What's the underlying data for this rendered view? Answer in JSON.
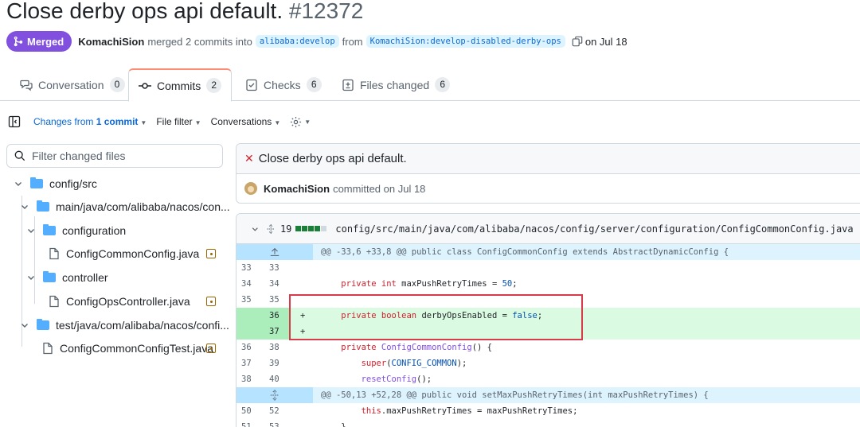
{
  "pr": {
    "title": "Close derby ops api default.",
    "number": "#12372",
    "status": "Merged",
    "author": "KomachiSion",
    "merge_text": "merged 2 commits into",
    "base_branch": "alibaba:develop",
    "from_text": "from",
    "head_branch": "KomachiSion:develop-disabled-derby-ops",
    "date_text": "on Jul 18"
  },
  "tabs": [
    {
      "label": "Conversation",
      "count": "0"
    },
    {
      "label": "Commits",
      "count": "2"
    },
    {
      "label": "Checks",
      "count": "6"
    },
    {
      "label": "Files changed",
      "count": "6"
    }
  ],
  "toolbar": {
    "changes_prefix": "Changes from",
    "changes_value": "1 commit",
    "file_filter": "File filter",
    "conversations": "Conversations"
  },
  "sidebar": {
    "filter_placeholder": "Filter changed files",
    "tree": [
      {
        "label": "config/src",
        "type": "folder"
      },
      {
        "label": "main/java/com/alibaba/nacos/con...",
        "type": "folder"
      },
      {
        "label": "configuration",
        "type": "folder"
      },
      {
        "label": "ConfigCommonConfig.java",
        "type": "file"
      },
      {
        "label": "controller",
        "type": "folder"
      },
      {
        "label": "ConfigOpsController.java",
        "type": "file"
      },
      {
        "label": "test/java/com/alibaba/nacos/confi...",
        "type": "folder"
      },
      {
        "label": "ConfigCommonConfigTest.java",
        "type": "file"
      }
    ]
  },
  "commit": {
    "title": "Close derby ops api default.",
    "author": "KomachiSion",
    "meta": "committed on Jul 18"
  },
  "file": {
    "changes": "19",
    "path": "config/src/main/java/com/alibaba/nacos/config/server/configuration/ConfigCommonConfig.java",
    "hunk1": "@@ -33,6 +33,8 @@ public class ConfigCommonConfig extends AbstractDynamicConfig {",
    "hunk2": "@@ -50,13 +52,28 @@ public void setMaxPushRetryTimes(int maxPushRetryTimes) {",
    "lines": [
      {
        "a": "33",
        "b": "33",
        "code": ""
      },
      {
        "a": "34",
        "b": "34",
        "code": "    private int maxPushRetryTimes = 50;"
      },
      {
        "a": "35",
        "b": "35",
        "code": ""
      },
      {
        "a": "",
        "b": "36",
        "sign": "+",
        "code": "    private boolean derbyOpsEnabled = false;"
      },
      {
        "a": "",
        "b": "37",
        "sign": "+",
        "code": ""
      },
      {
        "a": "36",
        "b": "38",
        "code": "    private ConfigCommonConfig() {"
      },
      {
        "a": "37",
        "b": "39",
        "code": "        super(CONFIG_COMMON);"
      },
      {
        "a": "38",
        "b": "40",
        "code": "        resetConfig();"
      },
      {
        "a": "50",
        "b": "52",
        "code": "        this.maxPushRetryTimes = maxPushRetryTimes;"
      },
      {
        "a": "51",
        "b": "53",
        "code": "    }"
      }
    ]
  },
  "colors": {
    "merged": "#8250df",
    "addition": "#dafbe1",
    "hunk": "#ddf4ff",
    "highlight_box": "#d73a49"
  }
}
